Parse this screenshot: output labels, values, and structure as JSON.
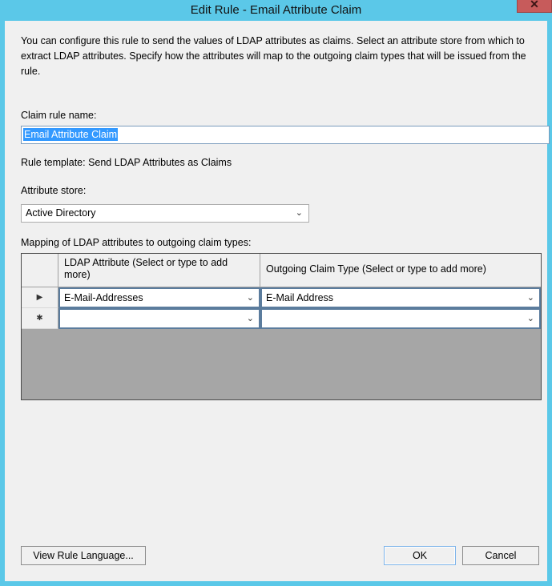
{
  "window": {
    "title": "Edit Rule - Email Attribute Claim",
    "close_icon": "close-icon",
    "titlebar_color": "#5BC8E8",
    "body_color": "#F0F0F0"
  },
  "description": "You can configure this rule to send the values of LDAP attributes as claims. Select an attribute store from which to extract LDAP attributes. Specify how the attributes will map to the outgoing claim types that will be issued from the rule.",
  "claim_rule_name": {
    "label": "Claim rule name:",
    "value": "Email Attribute Claim",
    "selected": true,
    "selection_color": "#3399FF"
  },
  "rule_template": {
    "text": "Rule template: Send LDAP Attributes as Claims"
  },
  "attribute_store": {
    "label": "Attribute store:",
    "value": "Active Directory",
    "chevron": "⌄"
  },
  "mapping": {
    "label": "Mapping of LDAP attributes to outgoing claim types:",
    "columns": [
      "LDAP Attribute (Select or type to add more)",
      "Outgoing Claim Type (Select or type to add more)"
    ],
    "rows": [
      {
        "marker": "▶",
        "ldap_attribute": "E-Mail-Addresses",
        "outgoing_claim_type": "E-Mail Address"
      },
      {
        "marker": "✱",
        "ldap_attribute": "",
        "outgoing_claim_type": ""
      }
    ],
    "chevron": "⌄"
  },
  "footer": {
    "view_rule_language": "View Rule Language...",
    "ok": "OK",
    "cancel": "Cancel"
  }
}
